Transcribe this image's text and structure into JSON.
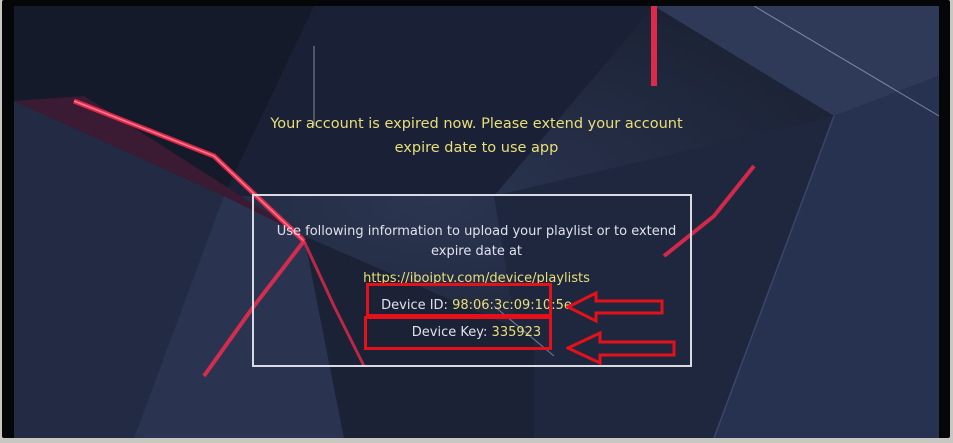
{
  "message": {
    "line1": "Your account is expired now. Please extend your account",
    "line2": "expire date to use app"
  },
  "info": {
    "line1": "Use following information to upload your playlist or to extend",
    "line2": "expire date at",
    "url": "https://iboiptv.com/device/playlists",
    "device_id_label": "Device ID:",
    "device_id_value": "98:06:3c:09:10:5e",
    "device_key_label": "Device Key:",
    "device_key_value": "335923"
  },
  "colors": {
    "accent_yellow": "#e9df79",
    "highlight_red": "#e4111b",
    "background": "#1c2438"
  }
}
